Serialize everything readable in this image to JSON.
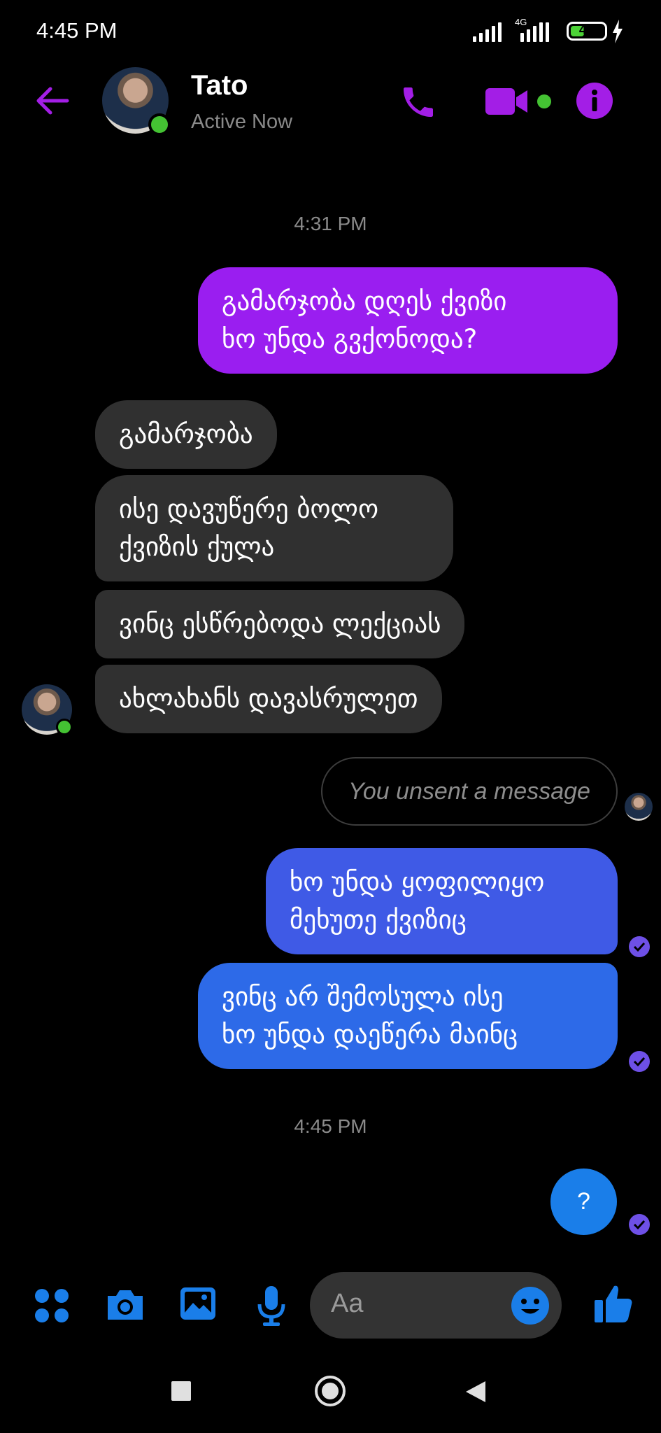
{
  "status_bar": {
    "time": "4:45 PM",
    "network": "4G",
    "battery": "42",
    "battery_level": 0.42
  },
  "header": {
    "contact_name": "Tato",
    "presence": "Active Now"
  },
  "timestamps": [
    "4:31 PM",
    "4:45 PM"
  ],
  "messages": {
    "out_1": "გამარჯობა დღეს ქვიზი\nხო უნდა  გვქონოდა?",
    "in_1": "გამარჯობა",
    "in_2": "ისე დავუწერე ბოლო\nქვიზის ქულა",
    "in_3": "ვინც ესწრებოდა ლექციას",
    "in_4": "ახლახანს დავასრულეთ",
    "unsent": "You unsent a message",
    "out_2": "ხო უნდა ყოფილიყო\nმეხუთე ქვიზიც",
    "out_3": "ვინც არ შემოსულა ისე\nხო უნდა დაეწერა მაინც",
    "quick_reply": "?"
  },
  "composer": {
    "placeholder": "Aa"
  },
  "colors": {
    "accent": "#a31ee6",
    "incoming_bubble": "#303030",
    "outgoing_top": "#9a1ef0",
    "outgoing_bottom": "#2d6ae8",
    "online": "#44c233",
    "tool_blue": "#1a7ee9"
  },
  "icons": {
    "back": "arrow-left-icon",
    "call": "phone-icon",
    "video": "video-camera-icon",
    "info": "info-icon",
    "menu": "four-dots-icon",
    "camera": "camera-icon",
    "gallery": "image-icon",
    "mic": "microphone-icon",
    "emoji": "smiley-icon",
    "like": "thumbs-up-icon"
  }
}
